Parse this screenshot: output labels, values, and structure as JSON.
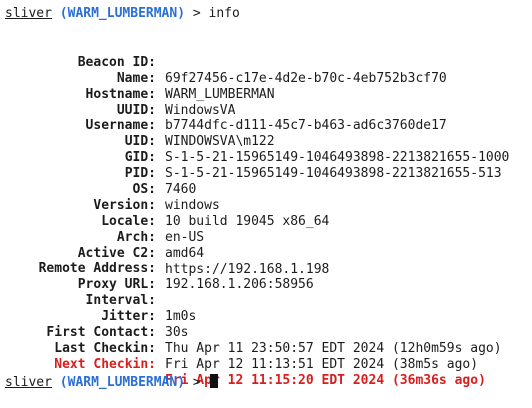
{
  "prompt": {
    "name": "sliver",
    "session": "(WARM_LUMBERMAN)",
    "symbol": ">",
    "command": "info"
  },
  "info": [
    {
      "key": "Beacon ID:",
      "value": "69f27456-c17e-4d2e-b70c-4eb752b3cf70"
    },
    {
      "key": "Name:",
      "value": "WARM_LUMBERMAN"
    },
    {
      "key": "Hostname:",
      "value": "WindowsVA"
    },
    {
      "key": "UUID:",
      "value": "b7744dfc-d111-45c7-b463-ad6c3760de17"
    },
    {
      "key": "Username:",
      "value": "WINDOWSVA\\m122"
    },
    {
      "key": "UID:",
      "value": "S-1-5-21-15965149-1046493898-2213821655-1000"
    },
    {
      "key": "GID:",
      "value": "S-1-5-21-15965149-1046493898-2213821655-513"
    },
    {
      "key": "PID:",
      "value": "7460"
    },
    {
      "key": "OS:",
      "value": "windows"
    },
    {
      "key": "Version:",
      "value": "10 build 19045 x86_64"
    },
    {
      "key": "Locale:",
      "value": "en-US"
    },
    {
      "key": "Arch:",
      "value": "amd64"
    },
    {
      "key": "Active C2:",
      "value": "https://192.168.1.198"
    },
    {
      "key": "Remote Address:",
      "value": "192.168.1.206:58956"
    },
    {
      "key": "Proxy URL:",
      "value": ""
    },
    {
      "key": "Interval:",
      "value": "1m0s"
    },
    {
      "key": "Jitter:",
      "value": "30s"
    },
    {
      "key": "First Contact:",
      "value": "Thu Apr 11 23:50:57 EDT 2024 (12h0m59s ago)"
    },
    {
      "key": "Last Checkin:",
      "value": "Fri Apr 12 11:13:51 EDT 2024 (38m5s ago)"
    },
    {
      "key": "Next Checkin:",
      "value": "Fri Apr 12 11:15:20 EDT 2024 (36m36s ago)"
    }
  ],
  "colors": {
    "session": "#2a6fd6",
    "overdue": "#d91e1e",
    "text": "#1c1c1c",
    "background": "#ffffff"
  }
}
